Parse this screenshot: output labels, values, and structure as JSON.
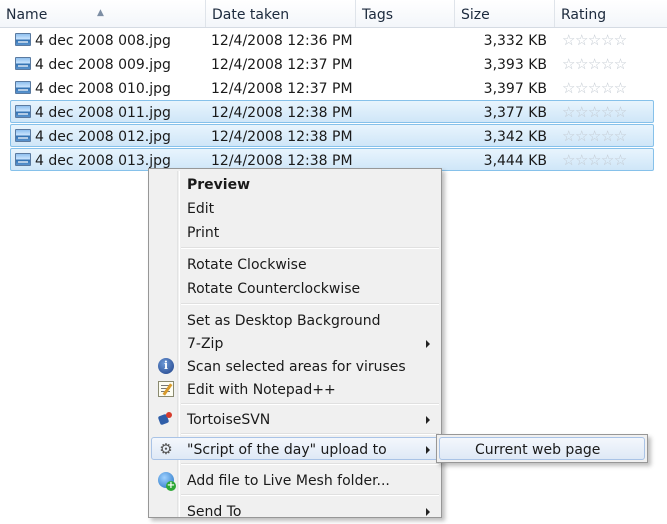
{
  "columns": {
    "name": "Name",
    "date_taken": "Date taken",
    "tags": "Tags",
    "size": "Size",
    "rating": "Rating"
  },
  "sort_indicator": "up",
  "files": [
    {
      "name": "4 dec 2008 008.jpg",
      "date_taken": "12/4/2008 12:36 PM",
      "tags": "",
      "size": "3,332 KB",
      "rating": "☆☆☆☆☆",
      "selected": false
    },
    {
      "name": "4 dec 2008 009.jpg",
      "date_taken": "12/4/2008 12:37 PM",
      "tags": "",
      "size": "3,393 KB",
      "rating": "☆☆☆☆☆",
      "selected": false
    },
    {
      "name": "4 dec 2008 010.jpg",
      "date_taken": "12/4/2008 12:37 PM",
      "tags": "",
      "size": "3,397 KB",
      "rating": "☆☆☆☆☆",
      "selected": false
    },
    {
      "name": "4 dec 2008 011.jpg",
      "date_taken": "12/4/2008 12:38 PM",
      "tags": "",
      "size": "3,377 KB",
      "rating": "☆☆☆☆☆",
      "selected": true
    },
    {
      "name": "4 dec 2008 012.jpg",
      "date_taken": "12/4/2008 12:38 PM",
      "tags": "",
      "size": "3,342 KB",
      "rating": "☆☆☆☆☆",
      "selected": true
    },
    {
      "name": "4 dec 2008 013.jpg",
      "date_taken": "12/4/2008 12:38 PM",
      "tags": "",
      "size": "3,444 KB",
      "rating": "☆☆☆☆☆",
      "selected": true
    }
  ],
  "context_menu": {
    "preview": "Preview",
    "edit": "Edit",
    "print": "Print",
    "rotate_cw": "Rotate Clockwise",
    "rotate_ccw": "Rotate Counterclockwise",
    "set_desktop_bg": "Set as Desktop Background",
    "seven_zip": "7-Zip",
    "scan_viruses": "Scan selected areas for viruses",
    "edit_notepad": "Edit with Notepad++",
    "tortoise_svn": "TortoiseSVN",
    "script_upload": "\"Script of the day\" upload to",
    "live_mesh": "Add file to Live Mesh folder...",
    "send_to": "Send To"
  },
  "submenu": {
    "current_web_page": "Current web page"
  },
  "icons": {
    "file": "jpg-image-icon",
    "scan": "antivirus-icon",
    "notepad": "notepad-plus-plus-icon",
    "svn": "tortoise-svn-icon",
    "script": "gear-icon",
    "mesh": "live-mesh-icon",
    "submenu_arrow": "chevron-right-icon"
  },
  "colors": {
    "selection_fill": "#cfe6f8",
    "selection_border": "#86c1ea",
    "menu_background": "#f0f0f0",
    "menu_hover_border": "#a9c3e6"
  }
}
